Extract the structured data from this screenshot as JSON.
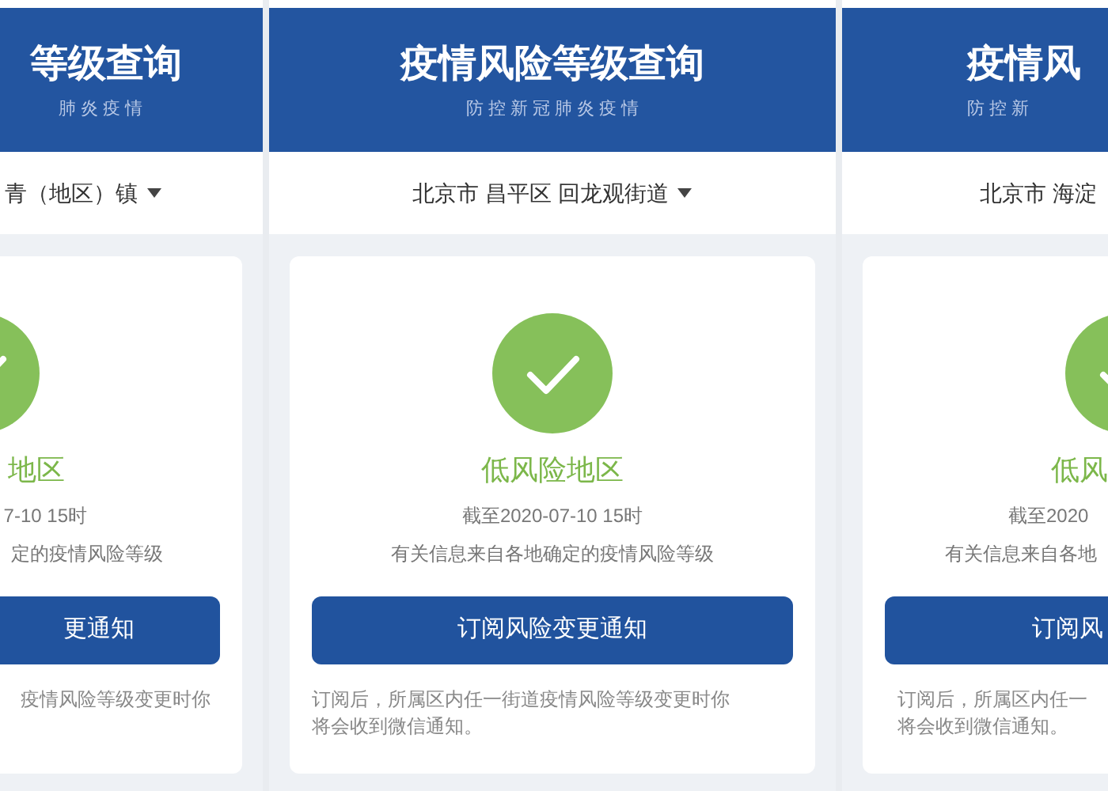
{
  "panels": [
    {
      "title": "等级查询",
      "subtitle": "肺 炎 疫 情",
      "location": "青（地区）镇",
      "caret": true,
      "level_label": "地区",
      "updated": "7-10 15时",
      "source_note": "定的疫情风险等级",
      "button": "更通知",
      "footnote_lines": [
        "疫情风险等级变更时你"
      ]
    },
    {
      "title": "疫情风险等级查询",
      "subtitle": "防 控 新 冠 肺 炎 疫 情",
      "location": "北京市 昌平区 回龙观街道",
      "caret": true,
      "level_label": "低风险地区",
      "updated": "截至2020-07-10 15时",
      "source_note": "有关信息来自各地确定的疫情风险等级",
      "button": "订阅风险变更通知",
      "footnote_lines": [
        "订阅后，所属区内任一街道疫情风险等级变更时你",
        "将会收到微信通知。"
      ]
    },
    {
      "title": "疫情风",
      "subtitle": "防 控 新",
      "location": "北京市 海淀",
      "caret": false,
      "level_label": "低风",
      "updated": "截至2020",
      "source_note": "有关信息来自各地",
      "button": "订阅风",
      "footnote_lines": [
        "订阅后，所属区内任一",
        "将会收到微信通知。"
      ]
    }
  ]
}
